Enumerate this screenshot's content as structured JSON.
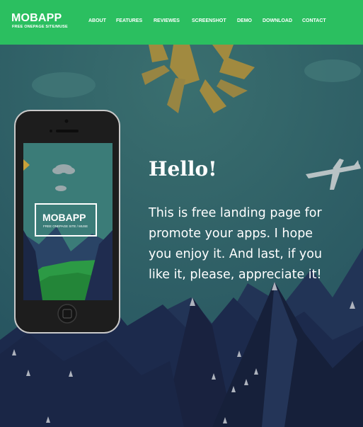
{
  "header": {
    "logo_title": "MOBAPP",
    "logo_tagline": "FREE ONEPAGE SITE/MUSE"
  },
  "nav": {
    "items": [
      "ABOUT",
      "FEATURES",
      "REVIEWES",
      "SCREENSHOT",
      "DEMO",
      "DOWNLOAD",
      "CONTACT"
    ]
  },
  "phone": {
    "screen_logo_title": "MOBAPP",
    "screen_logo_tagline": "FREE ONEPAGE SITE / MUSE"
  },
  "hero": {
    "heading": "Hello!",
    "text": "This is free landing page for promote your apps. I hope you enjoy it. And last, if you like it, please, appreciate it!"
  },
  "colors": {
    "header_bg": "#2bbf60",
    "sky": "#2c5e64",
    "sun": "#c9a13a",
    "mountain_dark": "#1c2848"
  }
}
